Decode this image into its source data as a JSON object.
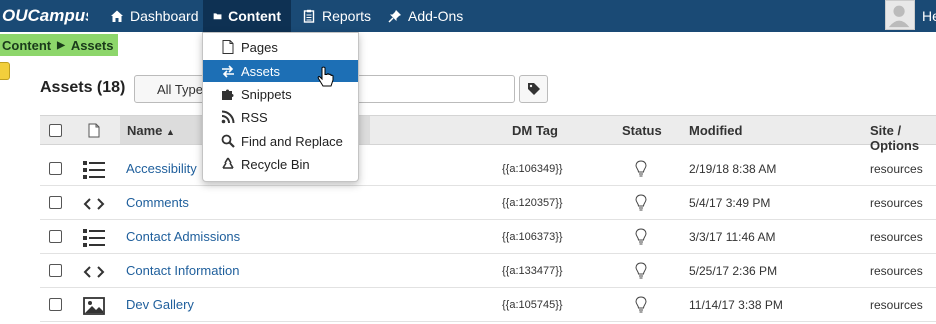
{
  "topbar": {
    "logo_text": "OUCampus",
    "nav": [
      {
        "label": "Dashboard",
        "icon": "home-icon"
      },
      {
        "label": "Content",
        "icon": "folder-icon"
      },
      {
        "label": "Reports",
        "icon": "clipboard-icon"
      },
      {
        "label": "Add-Ons",
        "icon": "pin-icon"
      }
    ],
    "user_name": "He"
  },
  "breadcrumb": {
    "items": [
      "Content",
      "Assets"
    ]
  },
  "toolbar": {
    "title": "Assets (18)",
    "filter_value": "All Types",
    "search_placeholder": ""
  },
  "table": {
    "columns": [
      "Name",
      "DM Tag",
      "Status",
      "Modified",
      "Site / Options"
    ],
    "sort_indicator": "▲",
    "rows": [
      {
        "name": "Accessibility",
        "type_icon": "list-icon",
        "dm_tag": "{{a:106349}}",
        "modified": "2/19/18 8:38 AM",
        "site": "resources"
      },
      {
        "name": "Comments",
        "type_icon": "code-icon",
        "dm_tag": "{{a:120357}}",
        "modified": "5/4/17 3:49 PM",
        "site": "resources"
      },
      {
        "name": "Contact Admissions",
        "type_icon": "list-icon",
        "dm_tag": "{{a:106373}}",
        "modified": "3/3/17 11:46 AM",
        "site": "resources"
      },
      {
        "name": "Contact Information",
        "type_icon": "code-icon",
        "dm_tag": "{{a:133477}}",
        "modified": "5/25/17 2:36 PM",
        "site": "resources"
      },
      {
        "name": "Dev Gallery",
        "type_icon": "image-icon",
        "dm_tag": "{{a:105745}}",
        "modified": "11/14/17 3:38 PM",
        "site": "resources"
      }
    ]
  },
  "dropdown": {
    "items": [
      {
        "label": "Pages",
        "icon": "page-icon",
        "selected": false
      },
      {
        "label": "Assets",
        "icon": "swap-icon",
        "selected": true
      },
      {
        "label": "Snippets",
        "icon": "puzzle-icon",
        "selected": false
      },
      {
        "label": "RSS",
        "icon": "rss-icon",
        "selected": false
      },
      {
        "label": "Find and Replace",
        "icon": "search-icon",
        "selected": false
      },
      {
        "label": "Recycle Bin",
        "icon": "recycle-icon",
        "selected": false
      }
    ]
  },
  "colors": {
    "nav_bg": "#1a4a75",
    "breadcrumb_bg": "#8dd66b",
    "selected": "#1d6fb5",
    "link": "#1f5f9c"
  }
}
